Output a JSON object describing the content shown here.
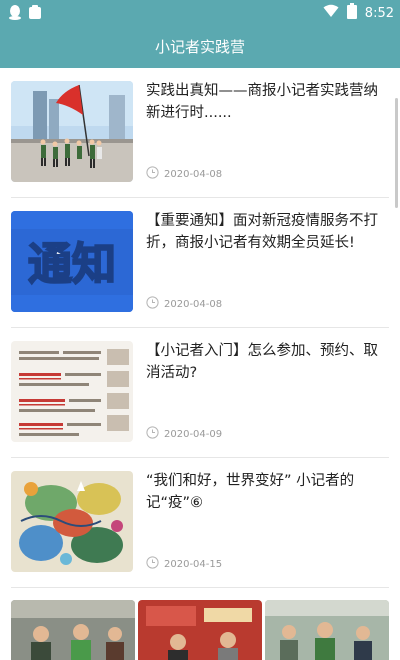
{
  "status_bar": {
    "time": "8:52"
  },
  "app_bar": {
    "title": "小记者实践营"
  },
  "articles": [
    {
      "title": "实践出真知——商报小记者实践营纳新进行时......",
      "date": "2020-04-08"
    },
    {
      "title": "【重要通知】面对新冠疫情服务不打折，商报小记者有效期全员延长!",
      "date": "2020-04-08",
      "thumb_text": "通知"
    },
    {
      "title": "【小记者入门】怎么参加、预约、取消活动?",
      "date": "2020-04-09"
    },
    {
      "title": "“我们和好，世界变好” 小记者的记“疫”⑥",
      "date": "2020-04-15"
    }
  ],
  "colors": {
    "accent": "#5ba9b0",
    "notice_blue": "#2f6fe0"
  }
}
